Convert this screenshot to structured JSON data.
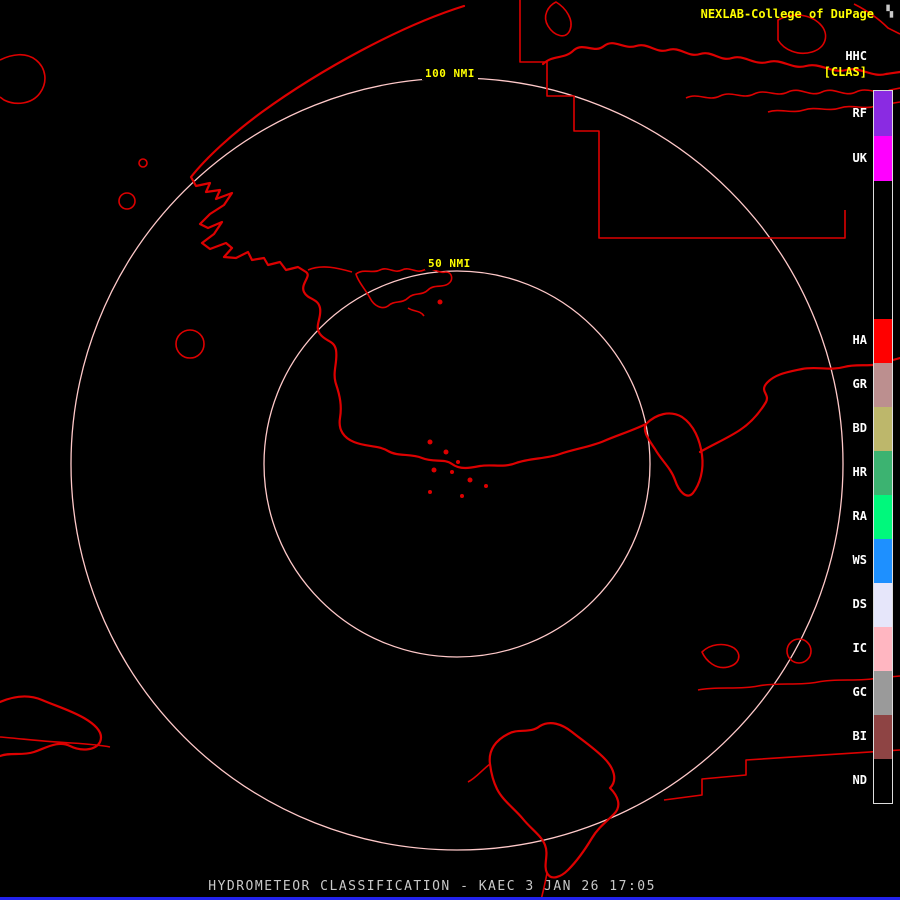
{
  "colors": {
    "background": "#000000",
    "map_outline": "#dd0000",
    "ring": "#ffc9c9",
    "ring_label": "#ffff00",
    "brand_text": "#ffff00",
    "product_code_text": "#ffffff",
    "mode_text": "#ffff00",
    "legend_label": "#ffffff",
    "legend_border": "#dddddd",
    "footer_text": "#c8c8c8",
    "footer_bar": "#2222ee"
  },
  "header": {
    "brand": "NEXLAB-College of DuPage",
    "logo_icon": "▚",
    "product_code": "HHC",
    "mode": "[CLAS]"
  },
  "rings": [
    {
      "label": "100 NMI"
    },
    {
      "label": "50 NMI"
    }
  ],
  "legend": {
    "categories": [
      {
        "label": "RF",
        "color": "#8a2be2"
      },
      {
        "label": "UK",
        "color": "#ff00ff"
      },
      {
        "label": "HA",
        "color": "#ff0000"
      },
      {
        "label": "GR",
        "color": "#bc8f8f"
      },
      {
        "label": "BD",
        "color": "#bdb76b"
      },
      {
        "label": "HR",
        "color": "#3cb371"
      },
      {
        "label": "RA",
        "color": "#00f87c"
      },
      {
        "label": "WS",
        "color": "#1e90ff"
      },
      {
        "label": "DS",
        "color": "#e6e6fa"
      },
      {
        "label": "IC",
        "color": "#ffb6c1"
      },
      {
        "label": "GC",
        "color": "#9a9a9a"
      },
      {
        "label": "BI",
        "color": "#8e4444"
      },
      {
        "label": "ND",
        "color": "#000000"
      }
    ]
  },
  "footer": {
    "title": "HYDROMETEOR CLASSIFICATION - KAEC 3 JAN 26 17:05"
  }
}
